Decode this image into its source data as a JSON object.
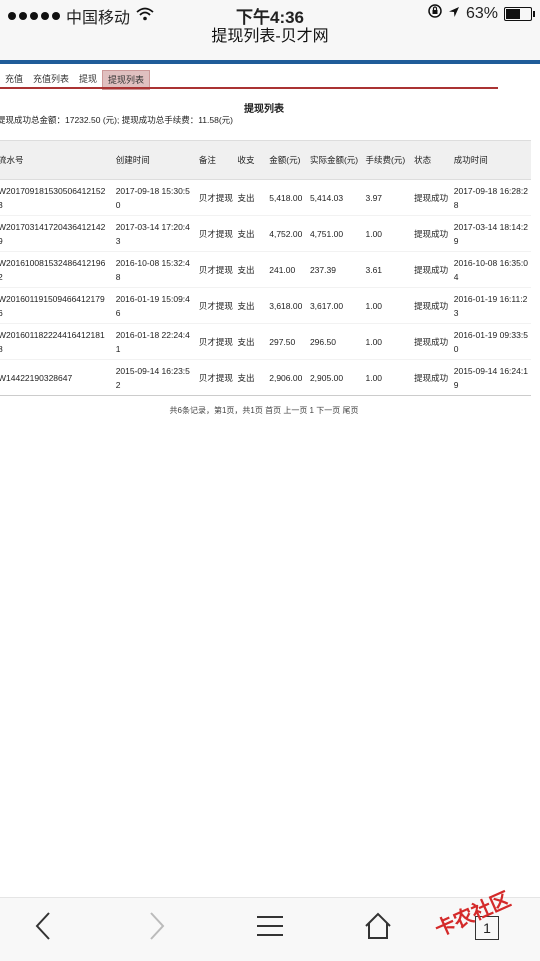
{
  "status": {
    "carrier": "中国移动",
    "time": "下午4:36",
    "battery": "63%",
    "battery_level": 0.63
  },
  "page_title": "提现列表-贝才网",
  "tabs": [
    "充值",
    "充值列表",
    "提现",
    "提现列表"
  ],
  "active_tab": 3,
  "list_title": "提现列表",
  "summary": "提现成功总金额：17232.50 (元); 提现成功总手续费：11.58(元)",
  "table": {
    "headers": [
      "流水号",
      "创建时间",
      "备注",
      "收支",
      "金额(元)",
      "实际金额(元)",
      "手续费(元)",
      "状态",
      "成功时间"
    ],
    "rows": [
      [
        "W201709181530506412152 3",
        "2017-09-18 15:30:5 0",
        "贝才提现",
        "支出",
        "5,418.00",
        "5,414.03",
        "3.97",
        "提现成功",
        "2017-09-18 16:28:2 8"
      ],
      [
        "W201703141720436412142 9",
        "2017-03-14 17:20:4 3",
        "贝才提现",
        "支出",
        "4,752.00",
        "4,751.00",
        "1.00",
        "提现成功",
        "2017-03-14 18:14:2 9"
      ],
      [
        "W201610081532486412196 2",
        "2016-10-08 15:32:4 8",
        "贝才提现",
        "支出",
        "241.00",
        "237.39",
        "3.61",
        "提现成功",
        "2016-10-08 16:35:0 4"
      ],
      [
        "W201601191509466412179 6",
        "2016-01-19 15:09:4 6",
        "贝才提现",
        "支出",
        "3,618.00",
        "3,617.00",
        "1.00",
        "提现成功",
        "2016-01-19 16:11:23"
      ],
      [
        "W201601182224416412181 8",
        "2016-01-18 22:24:4 1",
        "贝才提现",
        "支出",
        "297.50",
        "296.50",
        "1.00",
        "提现成功",
        "2016-01-19 09:33:5 0"
      ],
      [
        "W14422190328647",
        "2015-09-14 16:23:5 2",
        "贝才提现",
        "支出",
        "2,906.00",
        "2,905.00",
        "1.00",
        "提现成功",
        "2015-09-14 16:24:1 9"
      ]
    ]
  },
  "pager": "共6条记录，第1页，共1页 首页 上一页 1 下一页 尾页",
  "bottom": {
    "tab_count": "1"
  },
  "watermark": "卡农社区",
  "icons": [
    "wifi-icon",
    "lock-rotation-icon",
    "location-arrow-icon",
    "back-icon",
    "forward-icon",
    "menu-icon",
    "home-icon",
    "tabs-icon"
  ]
}
